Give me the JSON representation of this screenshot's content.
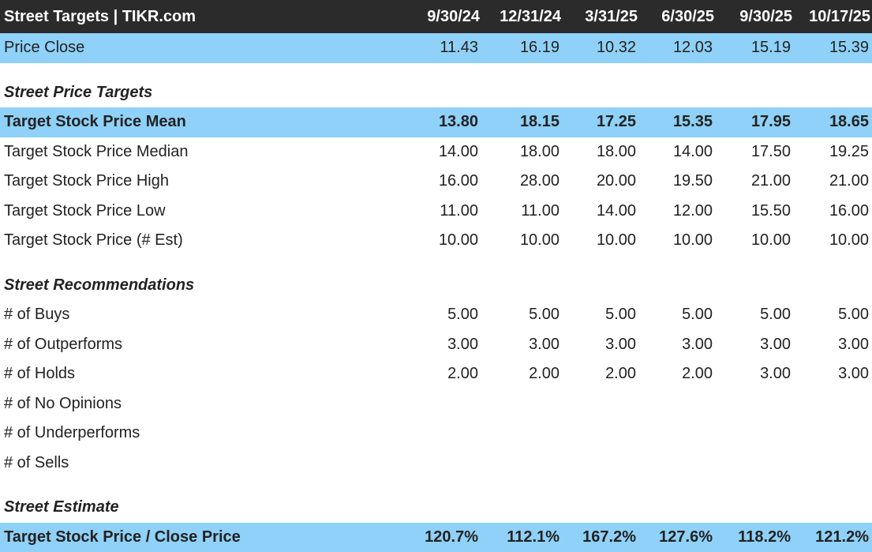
{
  "header": {
    "title": "Street Targets | TIKR.com",
    "dates": [
      "9/30/24",
      "12/31/24",
      "3/31/25",
      "6/30/25",
      "9/30/25",
      "10/17/25"
    ]
  },
  "price_close": {
    "label": "Price Close",
    "values": [
      "11.43",
      "16.19",
      "10.32",
      "12.03",
      "15.19",
      "15.39"
    ]
  },
  "street_price_targets": {
    "title": "Street Price Targets",
    "rows": [
      {
        "label": "Target Stock Price Mean",
        "values": [
          "13.80",
          "18.15",
          "17.25",
          "15.35",
          "17.95",
          "18.65"
        ]
      },
      {
        "label": "Target Stock Price Median",
        "values": [
          "14.00",
          "18.00",
          "18.00",
          "14.00",
          "17.50",
          "19.25"
        ]
      },
      {
        "label": "Target Stock Price High",
        "values": [
          "16.00",
          "28.00",
          "20.00",
          "19.50",
          "21.00",
          "21.00"
        ]
      },
      {
        "label": "Target Stock Price Low",
        "values": [
          "11.00",
          "11.00",
          "14.00",
          "12.00",
          "15.50",
          "16.00"
        ]
      },
      {
        "label": "Target Stock Price (# Est)",
        "values": [
          "10.00",
          "10.00",
          "10.00",
          "10.00",
          "10.00",
          "10.00"
        ]
      }
    ]
  },
  "street_recommendations": {
    "title": "Street Recommendations",
    "rows": [
      {
        "label": "# of Buys",
        "values": [
          "5.00",
          "5.00",
          "5.00",
          "5.00",
          "5.00",
          "5.00"
        ]
      },
      {
        "label": "# of Outperforms",
        "values": [
          "3.00",
          "3.00",
          "3.00",
          "3.00",
          "3.00",
          "3.00"
        ]
      },
      {
        "label": "# of Holds",
        "values": [
          "2.00",
          "2.00",
          "2.00",
          "2.00",
          "3.00",
          "3.00"
        ]
      },
      {
        "label": "# of No Opinions",
        "values": [
          "",
          "",
          "",
          "",
          "",
          ""
        ]
      },
      {
        "label": "# of Underperforms",
        "values": [
          "",
          "",
          "",
          "",
          "",
          ""
        ]
      },
      {
        "label": "# of Sells",
        "values": [
          "",
          "",
          "",
          "",
          "",
          ""
        ]
      }
    ]
  },
  "street_estimate": {
    "title": "Street Estimate",
    "rows": [
      {
        "label": "Target Stock Price / Close Price",
        "values": [
          "120.7%",
          "112.1%",
          "167.2%",
          "127.6%",
          "118.2%",
          "121.2%"
        ]
      }
    ]
  },
  "colors": {
    "header_background": "#2b2b2b",
    "highlight_row": "#8fd1f8",
    "text": "#222222"
  }
}
